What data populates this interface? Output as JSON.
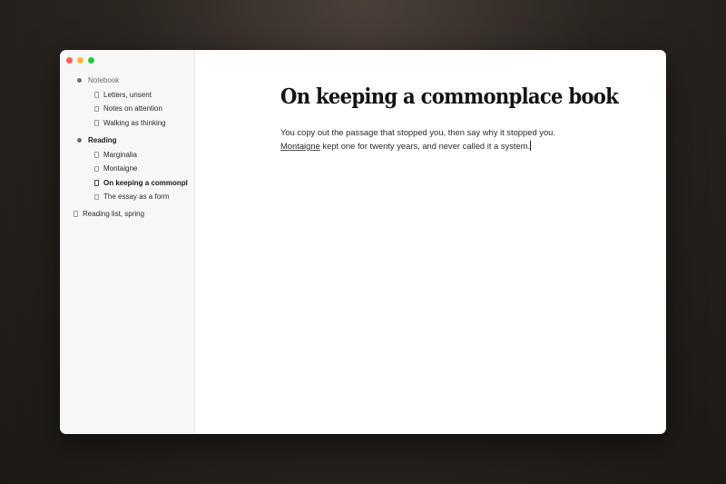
{
  "window": {
    "controls": [
      "close",
      "minimize",
      "zoom"
    ]
  },
  "sidebar": {
    "groups": [
      {
        "label": "Notebook",
        "items": [
          "Letters, unsent",
          "Notes on attention",
          "Walking as thinking"
        ]
      },
      {
        "label": "Reading",
        "items": [
          "Marginalia",
          "Montaigne",
          "On keeping a commonpl",
          "The essay as a form"
        ],
        "active_index": 2
      }
    ],
    "loose_page": "Reading list, spring"
  },
  "document": {
    "title": "On keeping a commonplace book",
    "line1": "You copy out the passage that stopped you, then say why it stopped you.",
    "link_text": "Montaigne",
    "line2_rest": " kept one for twenty years, and never called it a system."
  },
  "colors": {
    "close": "#fe5f57",
    "minimize": "#febc2e",
    "zoom": "#28c840"
  }
}
